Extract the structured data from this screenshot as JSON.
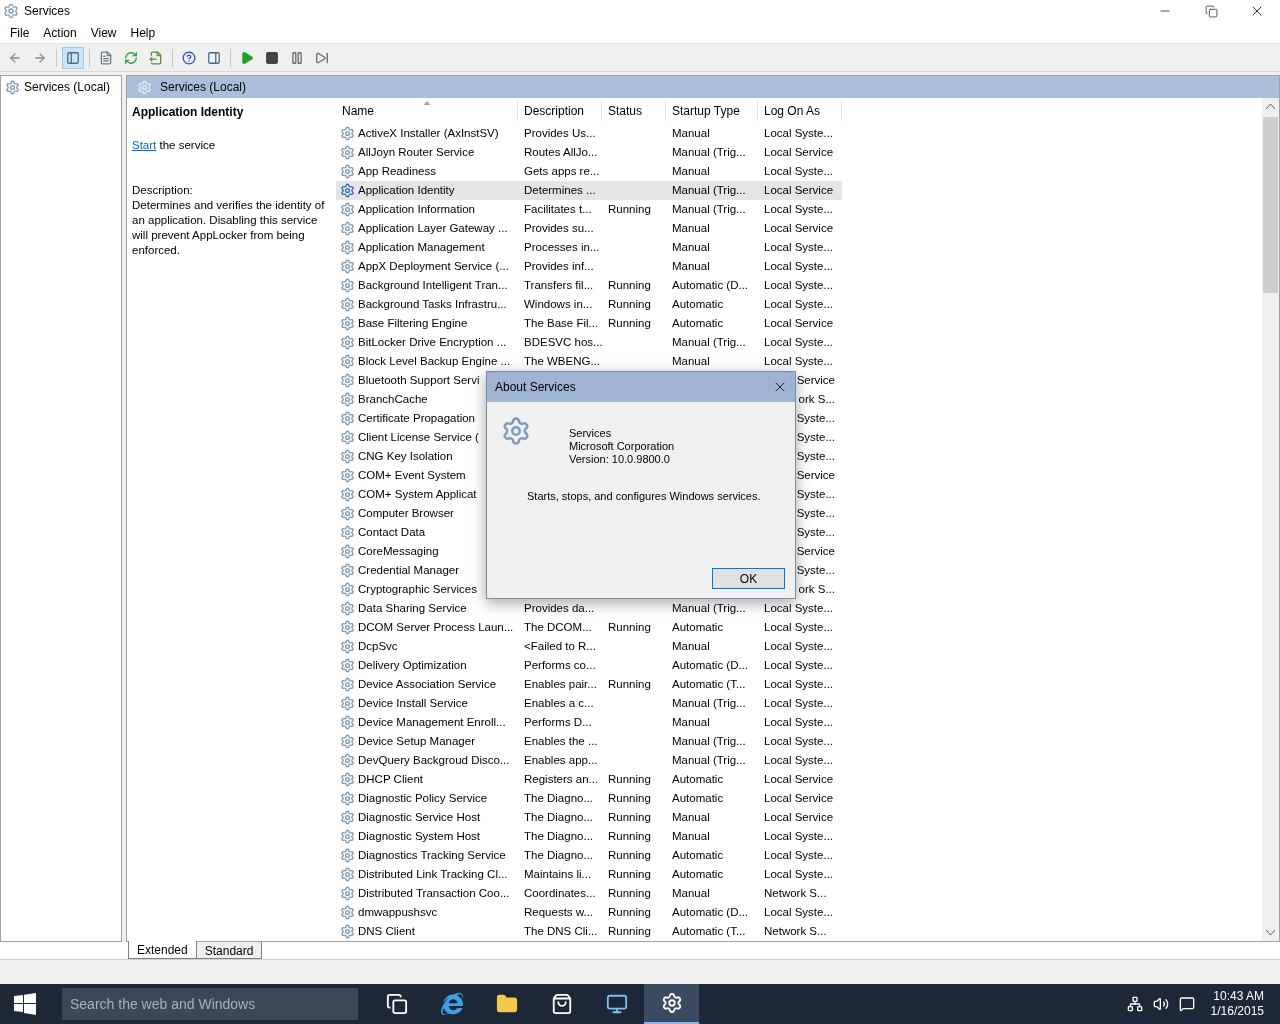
{
  "window": {
    "title": "Services"
  },
  "menu": [
    "File",
    "Action",
    "View",
    "Help"
  ],
  "toolbar": [
    {
      "kind": "back",
      "pressed": false
    },
    {
      "kind": "forward",
      "pressed": false
    },
    {
      "kind": "console-tree",
      "pressed": true
    },
    {
      "kind": "properties",
      "pressed": false
    },
    {
      "kind": "refresh",
      "pressed": false
    },
    {
      "kind": "export",
      "pressed": false
    },
    {
      "kind": "help",
      "pressed": false
    },
    {
      "kind": "action-pane",
      "pressed": false
    },
    {
      "kind": "start",
      "pressed": false
    },
    {
      "kind": "stop",
      "pressed": false
    },
    {
      "kind": "pause",
      "pressed": false
    },
    {
      "kind": "restart",
      "pressed": false
    }
  ],
  "tree": [
    {
      "label": "Services (Local)"
    }
  ],
  "panel_header": "Services (Local)",
  "details": {
    "title": "Application Identity",
    "action_link": "Start",
    "action_text": "the service",
    "description_label": "Description:",
    "description": "Determines and verifies the identity of an application. Disabling this service will prevent AppLocker from being enforced."
  },
  "table": {
    "columns": [
      {
        "label": "Name",
        "sorted": true
      },
      {
        "label": "Description",
        "sorted": false
      },
      {
        "label": "Status",
        "sorted": false
      },
      {
        "label": "Startup Type",
        "sorted": false
      },
      {
        "label": "Log On As",
        "sorted": false
      }
    ],
    "rows": [
      {
        "name": "ActiveX Installer (AxInstSV)",
        "description": "Provides Us...",
        "startup_type": "Manual",
        "log_on_as": "Local Syste...",
        "selected": false,
        "covered": false
      },
      {
        "name": "AllJoyn Router Service",
        "description": "Routes AllJo...",
        "startup_type": "Manual (Trig...",
        "log_on_as": "Local Service",
        "selected": false,
        "covered": false
      },
      {
        "name": "App Readiness",
        "description": "Gets apps re...",
        "startup_type": "Manual",
        "log_on_as": "Local Syste...",
        "selected": false,
        "covered": false
      },
      {
        "name": "Application Identity",
        "description": "Determines ...",
        "startup_type": "Manual (Trig...",
        "log_on_as": "Local Service",
        "selected": true,
        "covered": false
      },
      {
        "name": "Application Information",
        "description": "Facilitates t...",
        "status": "Running",
        "startup_type": "Manual (Trig...",
        "log_on_as": "Local Syste...",
        "selected": false,
        "covered": false
      },
      {
        "name": "Application Layer Gateway ...",
        "description": "Provides su...",
        "startup_type": "Manual",
        "log_on_as": "Local Service",
        "selected": false,
        "covered": false
      },
      {
        "name": "Application Management",
        "description": "Processes in...",
        "startup_type": "Manual",
        "log_on_as": "Local Syste...",
        "selected": false,
        "covered": false
      },
      {
        "name": "AppX Deployment Service (...",
        "description": "Provides inf...",
        "startup_type": "Manual",
        "log_on_as": "Local Syste...",
        "selected": false,
        "covered": false
      },
      {
        "name": "Background Intelligent Tran...",
        "description": "Transfers fil...",
        "status": "Running",
        "startup_type": "Automatic (D...",
        "log_on_as": "Local Syste...",
        "selected": false,
        "covered": false
      },
      {
        "name": "Background Tasks Infrastru...",
        "description": "Windows in...",
        "status": "Running",
        "startup_type": "Automatic",
        "log_on_as": "Local Syste...",
        "selected": false,
        "covered": false
      },
      {
        "name": "Base Filtering Engine",
        "description": "The Base Fil...",
        "status": "Running",
        "startup_type": "Automatic",
        "log_on_as": "Local Service",
        "selected": false,
        "covered": false
      },
      {
        "name": "BitLocker Drive Encryption ...",
        "description": "BDESVC hos...",
        "startup_type": "Manual (Trig...",
        "log_on_as": "Local Syste...",
        "selected": false,
        "covered": false
      },
      {
        "name": "Block Level Backup Engine ...",
        "description": "The WBENG...",
        "startup_type": "Manual",
        "log_on_as": "Local Syste...",
        "selected": false,
        "covered": false
      },
      {
        "name": "Bluetooth Support Servi",
        "log_on_as": "Service",
        "selected": false,
        "covered": true
      },
      {
        "name": "BranchCache",
        "log_on_as": "ork S...",
        "selected": false,
        "covered": true
      },
      {
        "name": "Certificate Propagation",
        "log_on_as": "Syste...",
        "selected": false,
        "covered": true
      },
      {
        "name": "Client License Service (",
        "log_on_as": "Syste...",
        "selected": false,
        "covered": true
      },
      {
        "name": "CNG Key Isolation",
        "log_on_as": "Syste...",
        "selected": false,
        "covered": true
      },
      {
        "name": "COM+ Event System",
        "log_on_as": "Service",
        "selected": false,
        "covered": true
      },
      {
        "name": "COM+ System Applicat",
        "log_on_as": "Syste...",
        "selected": false,
        "covered": true
      },
      {
        "name": "Computer Browser",
        "log_on_as": "Syste...",
        "selected": false,
        "covered": true
      },
      {
        "name": "Contact Data",
        "log_on_as": "Syste...",
        "selected": false,
        "covered": true
      },
      {
        "name": "CoreMessaging",
        "log_on_as": "Service",
        "selected": false,
        "covered": true
      },
      {
        "name": "Credential Manager",
        "log_on_as": "Syste...",
        "selected": false,
        "covered": true
      },
      {
        "name": "Cryptographic Services",
        "log_on_as": "ork S...",
        "selected": false,
        "covered": true
      },
      {
        "name": "Data Sharing Service",
        "description": "Provides da...",
        "startup_type": "Manual (Trig...",
        "log_on_as": "Local Syste...",
        "selected": false,
        "covered": false
      },
      {
        "name": "DCOM Server Process Laun...",
        "description": "The DCOM...",
        "status": "Running",
        "startup_type": "Automatic",
        "log_on_as": "Local Syste...",
        "selected": false,
        "covered": false
      },
      {
        "name": "DcpSvc",
        "description": "<Failed to R...",
        "startup_type": "Manual",
        "log_on_as": "Local Syste...",
        "selected": false,
        "covered": false
      },
      {
        "name": "Delivery Optimization",
        "description": "Performs co...",
        "startup_type": "Automatic (D...",
        "log_on_as": "Local Syste...",
        "selected": false,
        "covered": false
      },
      {
        "name": "Device Association Service",
        "description": "Enables pair...",
        "status": "Running",
        "startup_type": "Automatic (T...",
        "log_on_as": "Local Syste...",
        "selected": false,
        "covered": false
      },
      {
        "name": "Device Install Service",
        "description": "Enables a c...",
        "startup_type": "Manual (Trig...",
        "log_on_as": "Local Syste...",
        "selected": false,
        "covered": false
      },
      {
        "name": "Device Management Enroll...",
        "description": "Performs D...",
        "startup_type": "Manual",
        "log_on_as": "Local Syste...",
        "selected": false,
        "covered": false
      },
      {
        "name": "Device Setup Manager",
        "description": "Enables the ...",
        "startup_type": "Manual (Trig...",
        "log_on_as": "Local Syste...",
        "selected": false,
        "covered": false
      },
      {
        "name": "DevQuery Backgroud Disco...",
        "description": "Enables app...",
        "startup_type": "Manual (Trig...",
        "log_on_as": "Local Syste...",
        "selected": false,
        "covered": false
      },
      {
        "name": "DHCP Client",
        "description": "Registers an...",
        "status": "Running",
        "startup_type": "Automatic",
        "log_on_as": "Local Service",
        "selected": false,
        "covered": false
      },
      {
        "name": "Diagnostic Policy Service",
        "description": "The Diagno...",
        "status": "Running",
        "startup_type": "Automatic",
        "log_on_as": "Local Service",
        "selected": false,
        "covered": false
      },
      {
        "name": "Diagnostic Service Host",
        "description": "The Diagno...",
        "status": "Running",
        "startup_type": "Manual",
        "log_on_as": "Local Service",
        "selected": false,
        "covered": false
      },
      {
        "name": "Diagnostic System Host",
        "description": "The Diagno...",
        "status": "Running",
        "startup_type": "Manual",
        "log_on_as": "Local Syste...",
        "selected": false,
        "covered": false
      },
      {
        "name": "Diagnostics Tracking Service",
        "description": "The Diagno...",
        "status": "Running",
        "startup_type": "Automatic",
        "log_on_as": "Local Syste...",
        "selected": false,
        "covered": false
      },
      {
        "name": "Distributed Link Tracking Cl...",
        "description": "Maintains li...",
        "status": "Running",
        "startup_type": "Automatic",
        "log_on_as": "Local Syste...",
        "selected": false,
        "covered": false
      },
      {
        "name": "Distributed Transaction Coo...",
        "description": "Coordinates...",
        "status": "Running",
        "startup_type": "Manual",
        "log_on_as": "Network S...",
        "selected": false,
        "covered": false
      },
      {
        "name": "dmwappushsvc",
        "description": "Requests w...",
        "status": "Running",
        "startup_type": "Automatic (D...",
        "log_on_as": "Local Syste...",
        "selected": false,
        "covered": false
      },
      {
        "name": "DNS Client",
        "description": "The DNS Cli...",
        "status": "Running",
        "startup_type": "Automatic (T...",
        "log_on_as": "Network S...",
        "selected": false,
        "covered": false
      }
    ]
  },
  "tabs": [
    {
      "label": "Extended",
      "selected": true
    },
    {
      "label": "Standard",
      "selected": false
    }
  ],
  "dialog": {
    "title": "About Services",
    "product": "Services",
    "company": "Microsoft Corporation",
    "version": "Version: 10.0.9800.0",
    "description": "Starts, stops, and configures Windows services.",
    "ok_button": "OK"
  },
  "taskbar": {
    "search": {
      "placeholder": "Search the web and Windows"
    },
    "apps": [
      {
        "kind": "task-view",
        "active": false
      },
      {
        "kind": "browser",
        "active": false
      },
      {
        "kind": "folder",
        "active": false
      },
      {
        "kind": "store",
        "active": false
      },
      {
        "kind": "monitor",
        "active": false
      },
      {
        "kind": "gear",
        "active": true
      }
    ],
    "time": "10:43 AM",
    "date": "1/16/2015"
  }
}
